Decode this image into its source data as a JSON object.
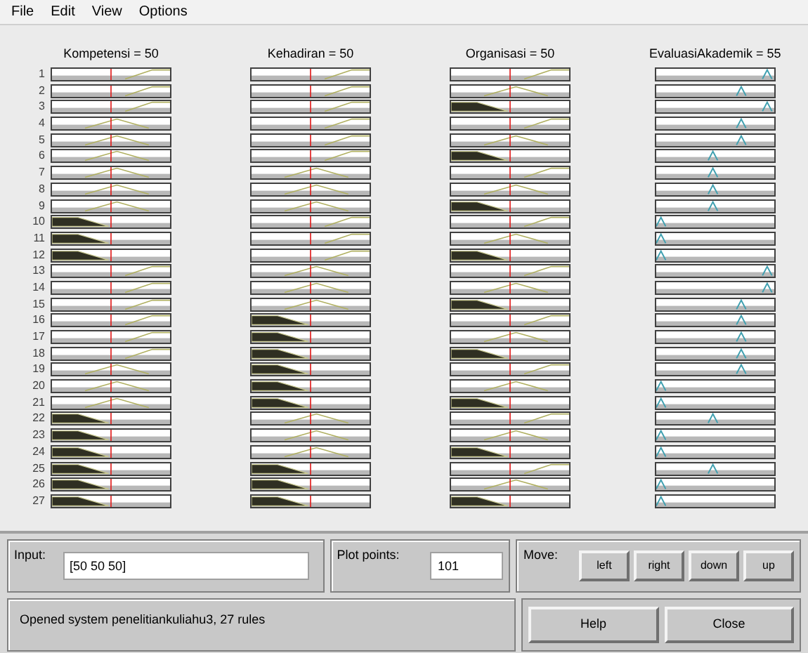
{
  "menu": [
    "File",
    "Edit",
    "View",
    "Options"
  ],
  "variables": [
    "Kompetensi = 50",
    "Kehadiran = 50",
    "Organisasi = 50",
    "EvaluasiAkademik = 55"
  ],
  "rules": [
    {
      "number": "1",
      "inputs": [
        {
          "kind": "high"
        },
        {
          "kind": "high"
        },
        {
          "kind": "high"
        }
      ],
      "output": {
        "kind": "vhigh"
      }
    },
    {
      "number": "2",
      "inputs": [
        {
          "kind": "high"
        },
        {
          "kind": "high"
        },
        {
          "kind": "mid"
        }
      ],
      "output": {
        "kind": "high"
      }
    },
    {
      "number": "3",
      "inputs": [
        {
          "kind": "high"
        },
        {
          "kind": "high"
        },
        {
          "kind": "low"
        }
      ],
      "output": {
        "kind": "vhigh"
      }
    },
    {
      "number": "4",
      "inputs": [
        {
          "kind": "mid"
        },
        {
          "kind": "high"
        },
        {
          "kind": "high"
        }
      ],
      "output": {
        "kind": "high"
      }
    },
    {
      "number": "5",
      "inputs": [
        {
          "kind": "mid"
        },
        {
          "kind": "high"
        },
        {
          "kind": "mid"
        }
      ],
      "output": {
        "kind": "high"
      }
    },
    {
      "number": "6",
      "inputs": [
        {
          "kind": "mid"
        },
        {
          "kind": "high"
        },
        {
          "kind": "low"
        }
      ],
      "output": {
        "kind": "mid"
      }
    },
    {
      "number": "7",
      "inputs": [
        {
          "kind": "mid"
        },
        {
          "kind": "mid"
        },
        {
          "kind": "high"
        }
      ],
      "output": {
        "kind": "mid"
      }
    },
    {
      "number": "8",
      "inputs": [
        {
          "kind": "mid"
        },
        {
          "kind": "mid"
        },
        {
          "kind": "mid"
        }
      ],
      "output": {
        "kind": "mid"
      }
    },
    {
      "number": "9",
      "inputs": [
        {
          "kind": "mid"
        },
        {
          "kind": "mid"
        },
        {
          "kind": "low"
        }
      ],
      "output": {
        "kind": "mid"
      }
    },
    {
      "number": "10",
      "inputs": [
        {
          "kind": "low"
        },
        {
          "kind": "high"
        },
        {
          "kind": "high"
        }
      ],
      "output": {
        "kind": "vlow"
      }
    },
    {
      "number": "11",
      "inputs": [
        {
          "kind": "low"
        },
        {
          "kind": "high"
        },
        {
          "kind": "mid"
        }
      ],
      "output": {
        "kind": "vlow"
      }
    },
    {
      "number": "12",
      "inputs": [
        {
          "kind": "low"
        },
        {
          "kind": "high"
        },
        {
          "kind": "low"
        }
      ],
      "output": {
        "kind": "vlow"
      }
    },
    {
      "number": "13",
      "inputs": [
        {
          "kind": "high"
        },
        {
          "kind": "mid"
        },
        {
          "kind": "high"
        }
      ],
      "output": {
        "kind": "vhigh"
      }
    },
    {
      "number": "14",
      "inputs": [
        {
          "kind": "high"
        },
        {
          "kind": "mid"
        },
        {
          "kind": "mid"
        }
      ],
      "output": {
        "kind": "vhigh"
      }
    },
    {
      "number": "15",
      "inputs": [
        {
          "kind": "high"
        },
        {
          "kind": "mid"
        },
        {
          "kind": "low"
        }
      ],
      "output": {
        "kind": "high"
      }
    },
    {
      "number": "16",
      "inputs": [
        {
          "kind": "high"
        },
        {
          "kind": "low"
        },
        {
          "kind": "high"
        }
      ],
      "output": {
        "kind": "high"
      }
    },
    {
      "number": "17",
      "inputs": [
        {
          "kind": "high"
        },
        {
          "kind": "low"
        },
        {
          "kind": "mid"
        }
      ],
      "output": {
        "kind": "high"
      }
    },
    {
      "number": "18",
      "inputs": [
        {
          "kind": "high"
        },
        {
          "kind": "low"
        },
        {
          "kind": "low"
        }
      ],
      "output": {
        "kind": "high"
      }
    },
    {
      "number": "19",
      "inputs": [
        {
          "kind": "mid"
        },
        {
          "kind": "low"
        },
        {
          "kind": "high"
        }
      ],
      "output": {
        "kind": "high"
      }
    },
    {
      "number": "20",
      "inputs": [
        {
          "kind": "mid"
        },
        {
          "kind": "low"
        },
        {
          "kind": "mid"
        }
      ],
      "output": {
        "kind": "vlow"
      }
    },
    {
      "number": "21",
      "inputs": [
        {
          "kind": "mid"
        },
        {
          "kind": "low"
        },
        {
          "kind": "low"
        }
      ],
      "output": {
        "kind": "vlow"
      }
    },
    {
      "number": "22",
      "inputs": [
        {
          "kind": "low"
        },
        {
          "kind": "mid"
        },
        {
          "kind": "high"
        }
      ],
      "output": {
        "kind": "mid"
      }
    },
    {
      "number": "23",
      "inputs": [
        {
          "kind": "low"
        },
        {
          "kind": "mid"
        },
        {
          "kind": "mid"
        }
      ],
      "output": {
        "kind": "vlow"
      }
    },
    {
      "number": "24",
      "inputs": [
        {
          "kind": "low"
        },
        {
          "kind": "mid"
        },
        {
          "kind": "low"
        }
      ],
      "output": {
        "kind": "vlow"
      }
    },
    {
      "number": "25",
      "inputs": [
        {
          "kind": "low"
        },
        {
          "kind": "low"
        },
        {
          "kind": "high"
        }
      ],
      "output": {
        "kind": "mid"
      }
    },
    {
      "number": "26",
      "inputs": [
        {
          "kind": "low"
        },
        {
          "kind": "low"
        },
        {
          "kind": "mid"
        }
      ],
      "output": {
        "kind": "vlow"
      }
    },
    {
      "number": "27",
      "inputs": [
        {
          "kind": "low"
        },
        {
          "kind": "low"
        },
        {
          "kind": "low"
        }
      ],
      "output": {
        "kind": "vlow"
      }
    }
  ],
  "input": {
    "label": "Input:",
    "value": "[50 50 50]"
  },
  "plot_points": {
    "label": "Plot points:",
    "value": "101"
  },
  "move": {
    "label": "Move:",
    "buttons": [
      "left",
      "right",
      "down",
      "up"
    ]
  },
  "status": "Opened system penelitiankuliahu3, 27 rules",
  "buttons": [
    "Help",
    "Close"
  ]
}
